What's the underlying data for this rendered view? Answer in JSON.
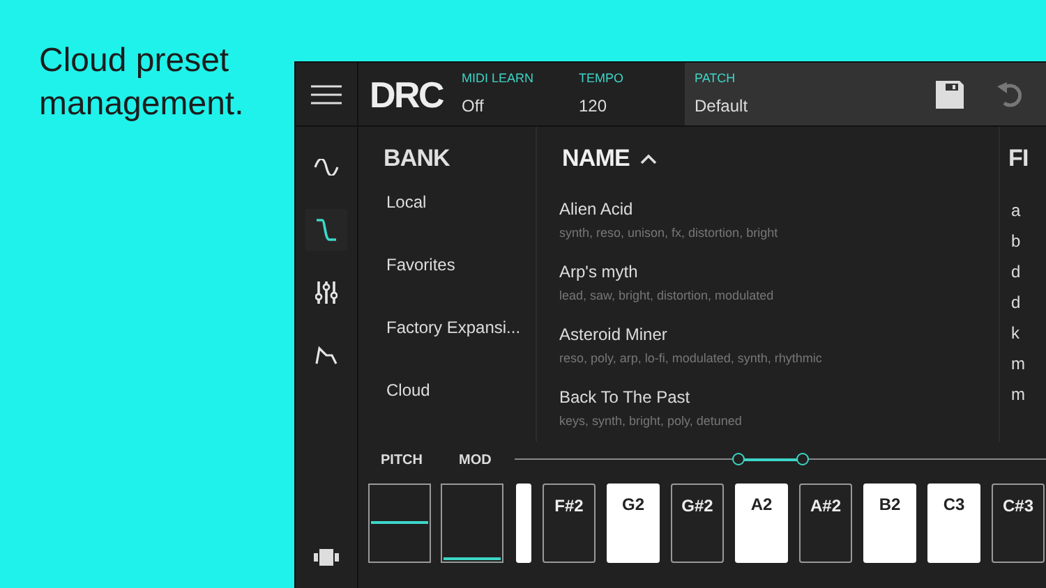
{
  "caption": "Cloud preset management.",
  "header": {
    "logo": "DRC",
    "fields": [
      {
        "label": "MIDI LEARN",
        "value": "Off"
      },
      {
        "label": "TEMPO",
        "value": "120"
      },
      {
        "label": "PATCH",
        "value": "Default"
      }
    ]
  },
  "sidebar": {
    "items": [
      {
        "kind": "wave",
        "selected": false
      },
      {
        "kind": "filter",
        "selected": true
      },
      {
        "kind": "mixer",
        "selected": false
      },
      {
        "kind": "envelope",
        "selected": false
      }
    ]
  },
  "browser": {
    "columns": [
      {
        "title": "BANK",
        "sort_ascending": false
      },
      {
        "title": "NAME",
        "sort_ascending": true
      },
      {
        "title": "FI",
        "sort_ascending": false
      }
    ],
    "banks": [
      "Local",
      "Favorites",
      "Factory Expansi...",
      "Cloud"
    ],
    "presets": [
      {
        "name": "Alien Acid",
        "tags": "synth, reso, unison, fx, distortion, bright"
      },
      {
        "name": "Arp's myth",
        "tags": "lead, saw, bright, distortion, modulated"
      },
      {
        "name": "Asteroid Miner",
        "tags": "reso, poly, arp, lo-fi, modulated, synth, rhythmic"
      },
      {
        "name": "Back To The Past",
        "tags": "keys, synth, bright, poly, detuned"
      }
    ],
    "column_3": [
      "a",
      "b",
      "d",
      "d",
      "k",
      "m",
      "m"
    ]
  },
  "keyboard": {
    "pitch": {
      "label": "PITCH",
      "level": 0.5
    },
    "mod": {
      "label": "MOD",
      "level": 0.02
    },
    "range_thumbs": [
      {
        "level": 0.42
      },
      {
        "level": 0.54
      }
    ],
    "keys": [
      {
        "kind": "white"
      },
      {
        "kind": "black",
        "label": "F#2"
      },
      {
        "kind": "white",
        "label": "G2"
      },
      {
        "kind": "black",
        "label": "G#2"
      },
      {
        "kind": "white",
        "label": "A2"
      },
      {
        "kind": "black",
        "label": "A#2"
      },
      {
        "kind": "white",
        "label": "B2"
      },
      {
        "kind": "white",
        "label": "C3"
      },
      {
        "kind": "black",
        "label": "C#3"
      }
    ]
  }
}
